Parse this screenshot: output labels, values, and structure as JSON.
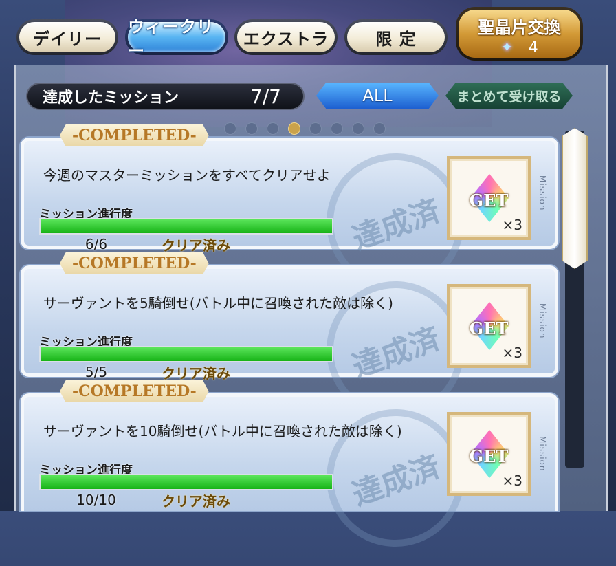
{
  "tabs": [
    {
      "label": "デイリー",
      "active": false
    },
    {
      "label": "ウィークリー",
      "active": true
    },
    {
      "label": "エクストラ",
      "active": false
    },
    {
      "label": "限 定",
      "active": false
    }
  ],
  "exchange": {
    "label": "聖晶片交換",
    "count": "4",
    "icon": "rainbow-star-icon"
  },
  "header": {
    "achieved_label": "達成したミッション",
    "achieved_value": "7/7",
    "filter_label": "ALL",
    "bulk_receive_label": "まとめて受け取る"
  },
  "pager": {
    "total": 8,
    "active_index": 3
  },
  "missions": [
    {
      "badge": "-COMPLETED-",
      "description": "今週のマスターミッションをすべてクリアせよ",
      "progress_label": "ミッション進行度",
      "progress_text": "6/6",
      "progress_fraction": 1.0,
      "status": "クリア済み",
      "stamp": "達成済",
      "reward_label": "GET",
      "reward_qty": "×3",
      "side_label": "Mission"
    },
    {
      "badge": "-COMPLETED-",
      "description": "サーヴァントを5騎倒せ(バトル中に召喚された敵は除く)",
      "progress_label": "ミッション進行度",
      "progress_text": "5/5",
      "progress_fraction": 1.0,
      "status": "クリア済み",
      "stamp": "達成済",
      "reward_label": "GET",
      "reward_qty": "×3",
      "side_label": "Mission"
    },
    {
      "badge": "-COMPLETED-",
      "description": "サーヴァントを10騎倒せ(バトル中に召喚された敵は除く)",
      "progress_label": "ミッション進行度",
      "progress_text": "10/10",
      "progress_fraction": 1.0,
      "status": "クリア済み",
      "stamp": "達成済",
      "reward_label": "GET",
      "reward_qty": "×3",
      "side_label": "Mission"
    }
  ]
}
